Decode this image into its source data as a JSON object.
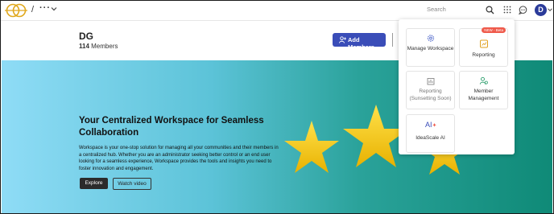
{
  "topbar": {
    "breadcrumb_sep": "/",
    "breadcrumb_more": "···",
    "search_placeholder": "Search",
    "avatar_initial": "D"
  },
  "header": {
    "title": "DG",
    "member_count": "114",
    "member_label": "Members",
    "add_members_label": "Add Members"
  },
  "hero": {
    "title": "Your Centralized Workspace for Seamless Collaboration",
    "description": "Workspace is your one-stop solution for managing all your communities and their members in a centralized hub. Whether you are an administrator seeking better control or an end user looking for a seamless experience, Workspace provides the tools and insights you need to foster innovation and engagement.",
    "explore_label": "Explore",
    "watch_label": "Watch video"
  },
  "menu": {
    "manage_workspace": "Manage Workspace",
    "reporting": "Reporting",
    "reporting_badge": "NEW - Beta",
    "reporting_sunsetting": "Reporting (Sunsetting Soon)",
    "member_management": "Member Management",
    "ideascale_ai": "IdeaScale AI"
  },
  "colors": {
    "accent": "#3a4db8",
    "badge": "#ef5a4b",
    "hero_left": "#8fdcf6",
    "hero_right": "#0f8a77",
    "star": "#f3cc1f"
  }
}
